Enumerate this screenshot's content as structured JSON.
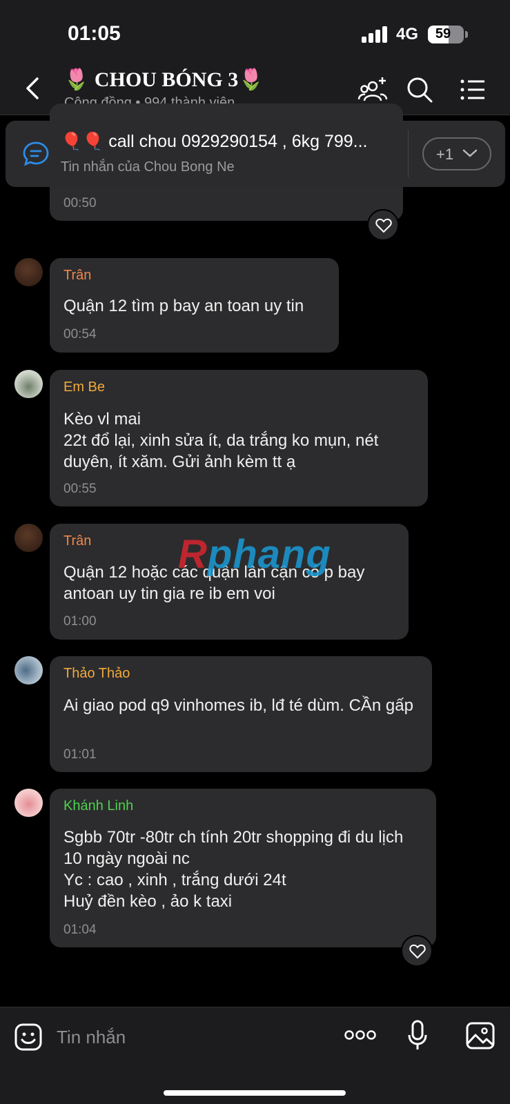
{
  "status_bar": {
    "time": "01:05",
    "network": "4G",
    "battery": "59"
  },
  "header": {
    "title": "🌷 CHOU BÓNG 3🌷",
    "subtitle": "Cộng đồng • 994 thành viên"
  },
  "pinned": {
    "text": "🎈🎈 call chou 0929290154 , 6kg 799...",
    "sub": "Tin nhắn của Chou Bong Ne",
    "more_label": "+1"
  },
  "first_message": {
    "time": "00:50"
  },
  "messages": [
    {
      "sender": "Trân",
      "color": "#f0874a",
      "text": "Quận 12 tìm p bay an toan uy tin",
      "time": "00:54"
    },
    {
      "sender": "Em Be",
      "color": "#f0a93c",
      "text": "Kèo vl mai\n22t đổ lại, xinh sửa ít, da trắng ko mụn, nét duyên, ít xăm. Gửi ảnh kèm tt ạ",
      "time": "00:55"
    },
    {
      "sender": "Trân",
      "color": "#f0874a",
      "text": "Quận 12 hoặc các quận lân cận có p bay antoan uy tin gia re ib em voi",
      "time": "01:00"
    },
    {
      "sender": "Thảo Thảo",
      "color": "#f0a93c",
      "text": "Ai giao pod q9 vinhomes ib, lđ té dùm. CẦn gấp",
      "time": "01:01"
    },
    {
      "sender": "Khánh Linh",
      "color": "#4fd14f",
      "text": "Sgbb 70tr -80tr ch tính 20tr shopping đi du lịch 10 ngày ngoài nc\nYc : cao , xinh , trắng dưới 24t\nHuỷ đền kèo , ảo k taxi",
      "time": "01:04"
    }
  ],
  "watermark": {
    "part1": "R",
    "part2": "phang"
  },
  "composer": {
    "placeholder": "Tin nhắn"
  }
}
